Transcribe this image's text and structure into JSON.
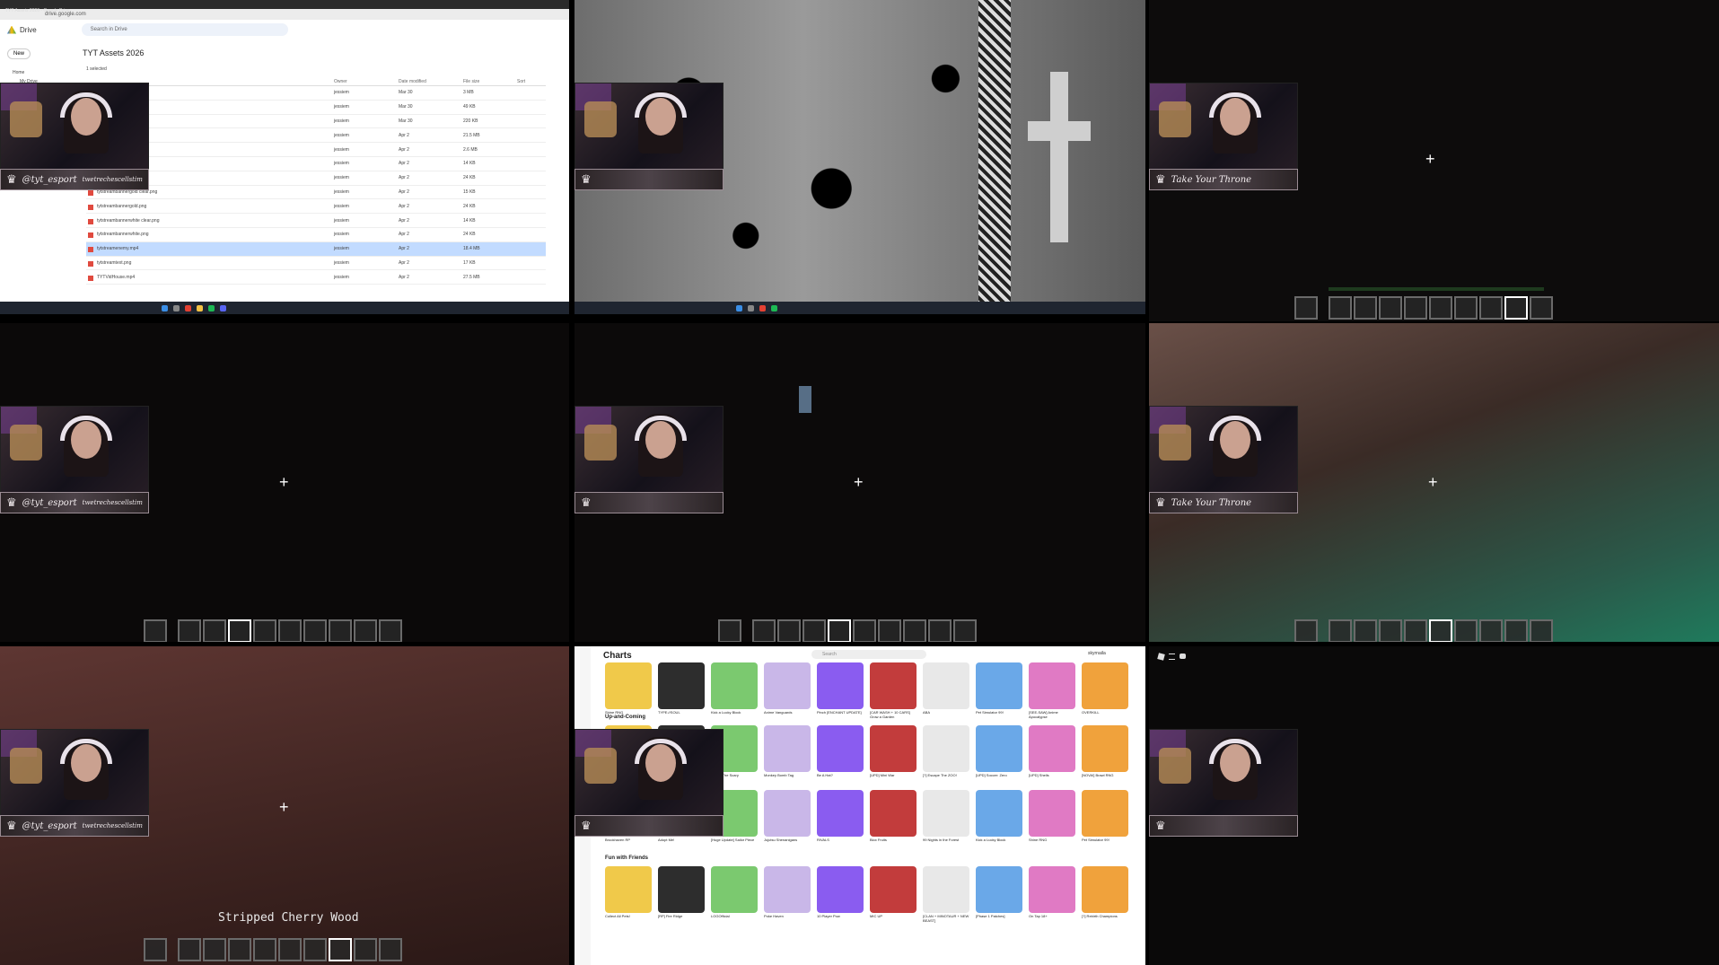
{
  "drive": {
    "tab_title": "TYT Assets 2026 - Google Drive",
    "app_name": "Drive",
    "search_placeholder": "Search in Drive",
    "folder_title": "TYT Assets 2026",
    "new_label": "New",
    "nav_home": "Home",
    "nav_mydrive": "My Drive",
    "selection_label": "1 selected",
    "columns": {
      "owner": "Owner",
      "modified": "Date modified",
      "size": "File size",
      "sort": "Sort"
    },
    "rows": [
      {
        "name": "",
        "owner": "jessiem",
        "date": "Mar 30",
        "size": "3 MB"
      },
      {
        "name": "",
        "owner": "jessiem",
        "date": "Mar 30",
        "size": "49 KB"
      },
      {
        "name": "",
        "owner": "jessiem",
        "date": "Mar 30",
        "size": "220 KB"
      },
      {
        "name": "",
        "owner": "jessiem",
        "date": "Apr 2",
        "size": "21.5 MB"
      },
      {
        "name": "",
        "owner": "jessiem",
        "date": "Apr 2",
        "size": "2.6 MB"
      },
      {
        "name": "...png",
        "owner": "jessiem",
        "date": "Apr 2",
        "size": "14 KB"
      },
      {
        "name": "...png",
        "owner": "jessiem",
        "date": "Apr 2",
        "size": "24 KB"
      },
      {
        "name": "tytstreambannergold clear.png",
        "owner": "jessiem",
        "date": "Apr 2",
        "size": "15 KB"
      },
      {
        "name": "tytstreambannergold.png",
        "owner": "jessiem",
        "date": "Apr 2",
        "size": "24 KB"
      },
      {
        "name": "tytstreambannerwhite clear.png",
        "owner": "jessiem",
        "date": "Apr 2",
        "size": "14 KB"
      },
      {
        "name": "tytstreambannerwhite.png",
        "owner": "jessiem",
        "date": "Apr 2",
        "size": "24 KB"
      },
      {
        "name": "tytstreamenemy.mp4",
        "owner": "jessiem",
        "date": "Apr 2",
        "size": "18.4 MB"
      },
      {
        "name": "tytstreamtext.png",
        "owner": "jessiem",
        "date": "Apr 2",
        "size": "17 KB"
      },
      {
        "name": "TYTVidHouse.mp4",
        "owner": "jessiem",
        "date": "Apr 2",
        "size": "27.5 MB"
      }
    ],
    "selected_row": 11
  },
  "overlays": {
    "banner_handle": "@tyt_esport",
    "banner_tag": "twetrechescellstim",
    "banner_throne": "Take Your Throne"
  },
  "game": {
    "caption": "Stripped Cherry Wood",
    "crosshair": "+"
  },
  "roblox": {
    "title": "Charts",
    "search_placeholder": "Search",
    "username": "skyrnaila",
    "sections": [
      "Up-and-Coming",
      "Fun with Friends"
    ],
    "row1": [
      "Shine RNG",
      "TYPE://SOUL",
      "Kick a Lucky Block",
      "Anime Vanguards",
      "Pinch [ENCHANT UPDATE]",
      "[CAR WASH + 10 CARS] Grow a Garden",
      "ABA",
      "Pet Simulator 99!",
      "[SEE-SAW] Anime Apocalypse",
      "OVERKILL"
    ],
    "row2": [
      "",
      "",
      "Shark: The Scary",
      "Monkey Bomb Tag",
      "Be A Hat?",
      "[UPD] Mini War",
      "[?] Escape The ZOO!",
      "[UPD] Soccer: Zero",
      "[UPD] Shells",
      "[NOVA!] Brawl RNG"
    ],
    "row3": [
      "Brookhaven RP",
      "Adopt Me!",
      "[Huge Update] Sailor Piece",
      "Jujutsu Shenanigans",
      "RIVALS",
      "Blox Fruits",
      "99 Nights in the Forest",
      "Kick a Lucky Block",
      "Shine RNG",
      "Pet Simulator 99!"
    ],
    "row4": [
      "Collect All Pets!",
      "[RP] Fire Ridge",
      "LOGOfficial",
      "Poke Haven",
      "10 Player Pow",
      "MIC UP",
      "[CLAN + MINOTAUR + NEW BEAST]",
      "[Phase 1 Patches]",
      "On Tap 18+",
      "[?] Rebirth Champions"
    ]
  },
  "colors": {
    "accent_blue": "#1a73e8",
    "selected_row": "#c2dbff",
    "banner_border": "#9a8c94"
  }
}
